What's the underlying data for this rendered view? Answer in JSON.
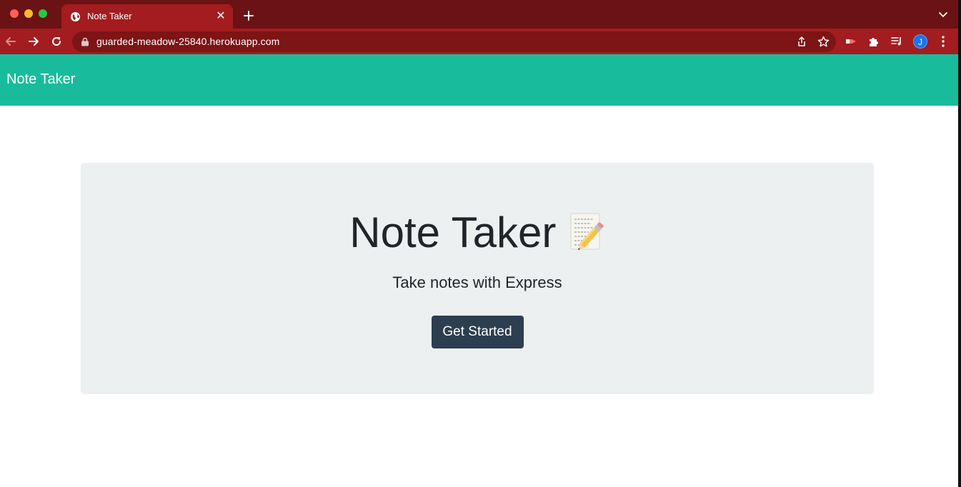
{
  "browser": {
    "tab": {
      "title": "Note Taker",
      "close_glyph": "✕",
      "favicon": "globe-icon"
    },
    "new_tab_glyph": "+",
    "url": "guarded-meadow-25840.herokuapp.com",
    "profile_initial": "J",
    "colors": {
      "tabstrip": "#6b1214",
      "toolbar": "#a31c1f",
      "omnibox": "#7d1416"
    }
  },
  "navbar": {
    "brand": "Note Taker",
    "color": "#18bc9c"
  },
  "hero": {
    "title": "Note Taker",
    "icon": "memo-pencil-icon",
    "subtitle": "Take notes with Express",
    "cta_label": "Get Started",
    "cta_color": "#2c3e50",
    "background": "#ecf0f1"
  }
}
